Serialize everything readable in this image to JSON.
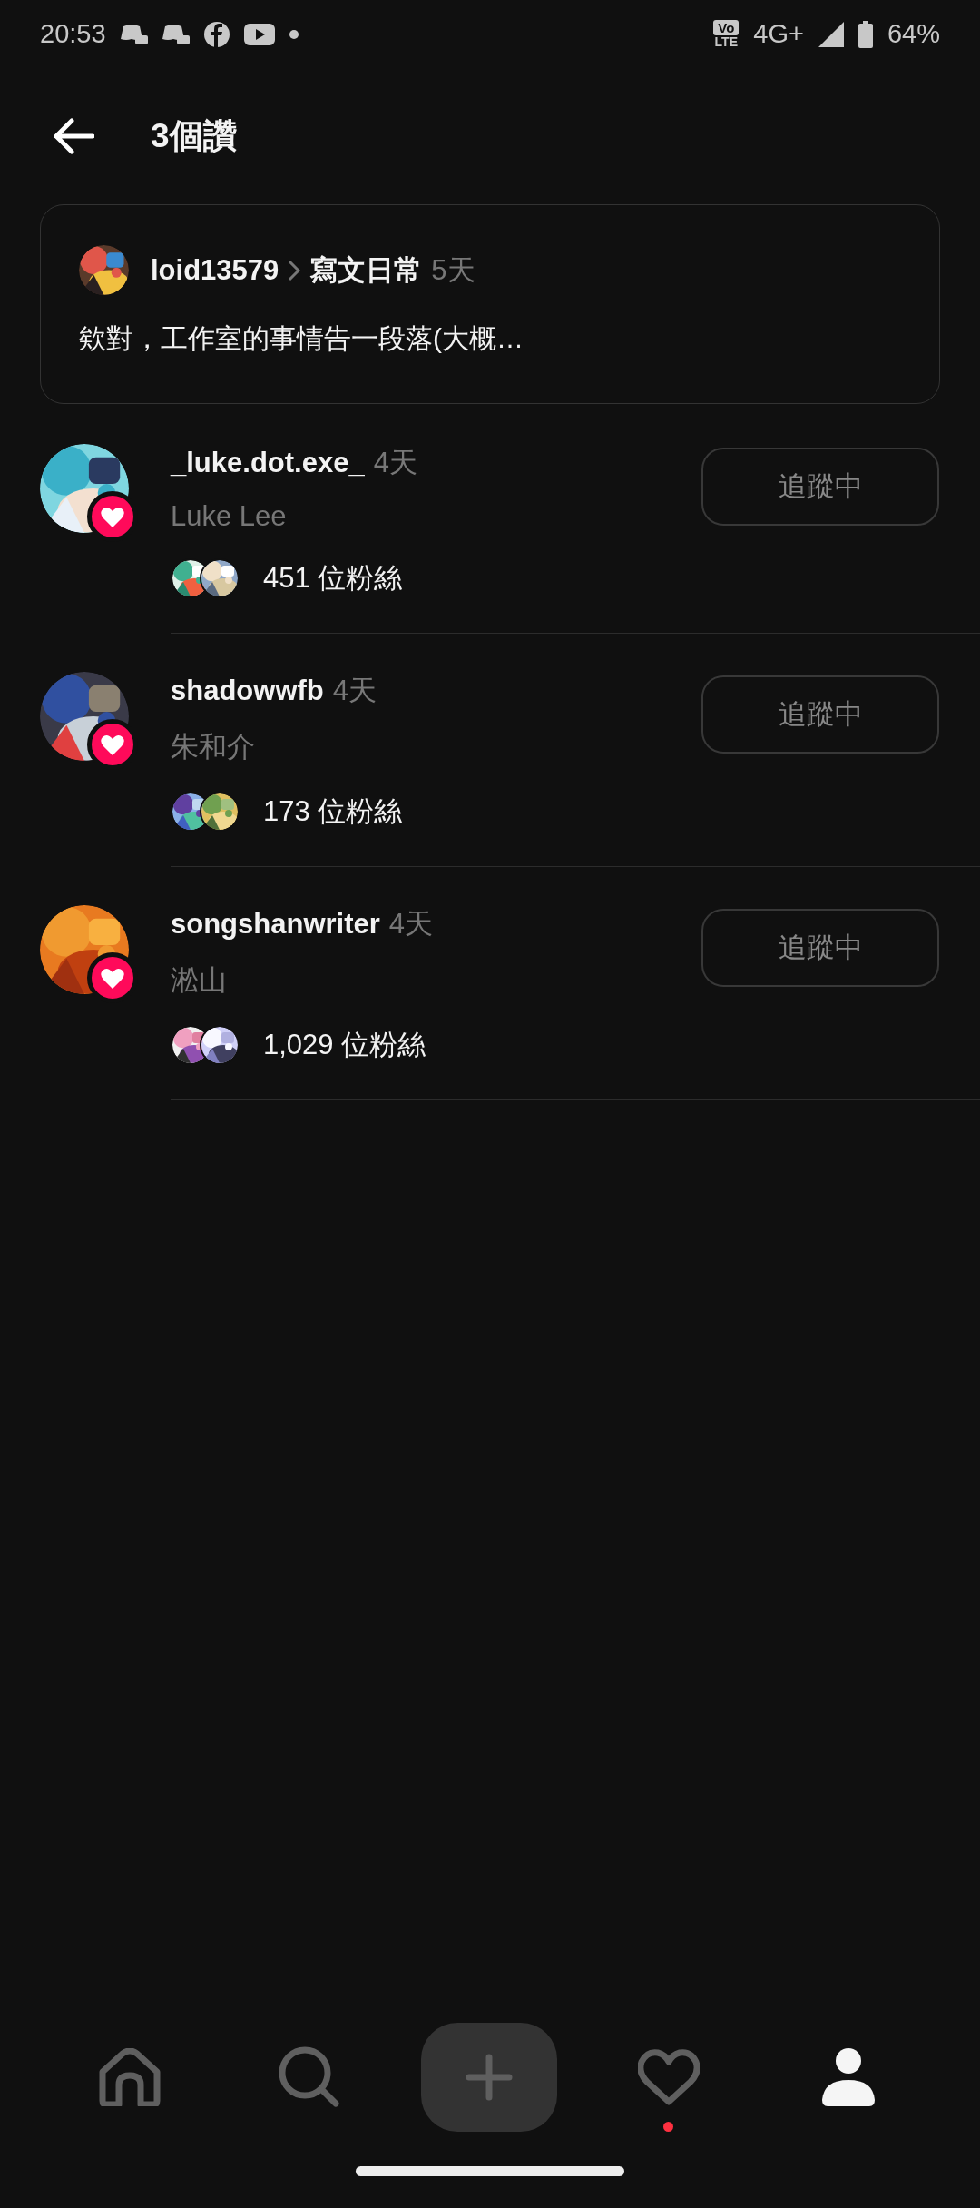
{
  "status_bar": {
    "time": "20:53",
    "volte_top": "Vo",
    "volte_bottom": "LTE",
    "network": "4G+",
    "battery": "64%"
  },
  "header": {
    "title": "3個讚"
  },
  "post": {
    "author": "loid13579",
    "topic": "寫文日常",
    "age": "5天",
    "excerpt": "欸對，工作室的事情告一段落(大概…"
  },
  "likers": [
    {
      "username": "_luke.dot.exe_",
      "age": "4天",
      "display_name": "Luke Lee",
      "followers": "451 位粉絲",
      "button": "追蹤中"
    },
    {
      "username": "shadowwfb",
      "age": "4天",
      "display_name": "朱和介",
      "followers": "173 位粉絲",
      "button": "追蹤中"
    },
    {
      "username": "songshanwriter",
      "age": "4天",
      "display_name": "淞山",
      "followers": "1,029 位粉絲",
      "button": "追蹤中"
    }
  ],
  "nav": [
    {
      "kind": "home",
      "selected": false,
      "badge": false
    },
    {
      "kind": "search",
      "selected": false,
      "badge": false
    },
    {
      "kind": "create",
      "selected": false,
      "badge": false
    },
    {
      "kind": "activity",
      "selected": false,
      "badge": true
    },
    {
      "kind": "profile",
      "selected": true,
      "badge": false
    }
  ]
}
